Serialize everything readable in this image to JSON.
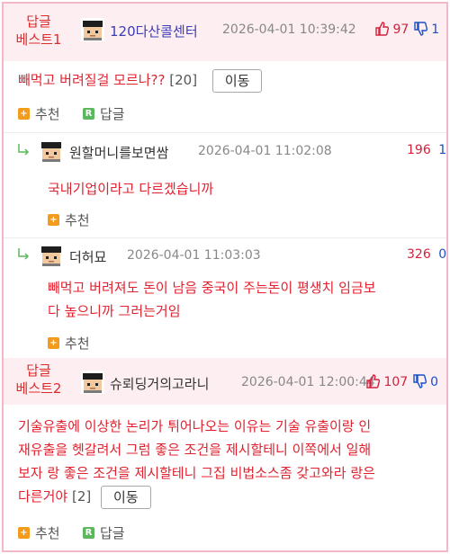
{
  "best1": {
    "tag_line1": "답글",
    "tag_line2": "베스트1",
    "nickname": "120다산콜센터",
    "date": "2026-04-01 10:39:42",
    "up": "97",
    "down": "1",
    "text": "빼먹고 버려질걸 모르나??",
    "reply_count": "[20]",
    "move_label": "이동",
    "recommend_label": "추천",
    "reply_label": "답글",
    "reply_badge": "R"
  },
  "sub1": {
    "nickname": "원할머니를보면쌈",
    "date": "2026-04-01 11:02:08",
    "up": "196",
    "down": "1",
    "text": "국내기업이라고 다르겠습니까",
    "recommend_label": "추천"
  },
  "sub2": {
    "nickname": "더허묘",
    "date": "2026-04-01 11:03:03",
    "up": "326",
    "down": "0",
    "text_line1": "빼먹고 버려져도 돈이 남음 중국이 주는돈이 평생치 임금보",
    "text_line2": "다 높으니까 그러는거임",
    "recommend_label": "추천"
  },
  "best2": {
    "tag_line1": "답글",
    "tag_line2": "베스트2",
    "nickname": "슈뢰딩거의고라니",
    "date": "2026-04-01 12:00:44",
    "up": "107",
    "down": "0",
    "text_line1": "기술유출에 이상한 논리가 튀어나오는 이유는 기술 유출이랑 인",
    "text_line2": "재유출을 헷갈려서 그럼 좋은 조건을 제시할테니 이쪽에서 일해",
    "text_line3": "보자 랑 좋은 조건을 제시할테니 그집 비법소스좀 갖고와라 랑은",
    "text_line4": "다른거야",
    "reply_count": "[2]",
    "move_label": "이동",
    "recommend_label": "추천",
    "reply_label": "답글",
    "reply_badge": "R"
  },
  "colors": {
    "best_bg": "#fdeef2",
    "accent_red": "#e02a2a",
    "up_red": "#d2223c",
    "down_blue": "#1a4fc8",
    "nick_link": "#3c3cb4",
    "frame_pink": "#f2b8c6"
  }
}
